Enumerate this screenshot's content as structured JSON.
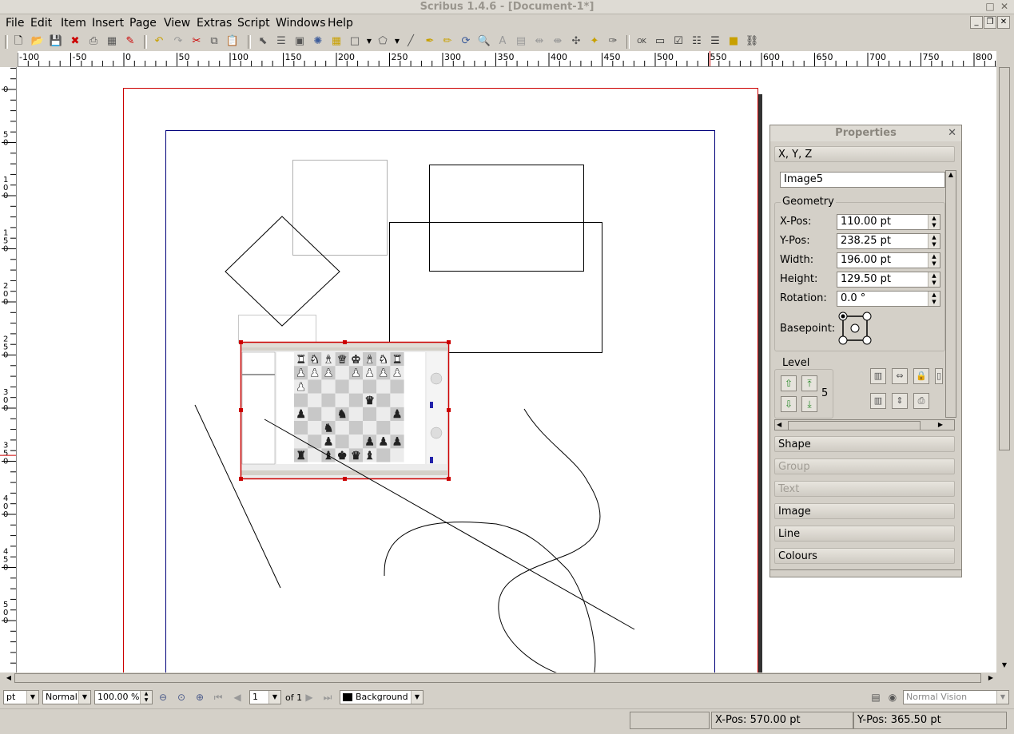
{
  "window": {
    "title": "Scribus 1.4.6 - [Document-1*]"
  },
  "menubar": {
    "items": [
      "File",
      "Edit",
      "Item",
      "Insert",
      "Page",
      "View",
      "Extras",
      "Script",
      "Windows",
      "Help"
    ]
  },
  "toolbar": {
    "icons": [
      "new-document-icon",
      "open-icon",
      "save-icon",
      "close-icon",
      "print-icon",
      "preflight-icon",
      "pdf-export-icon",
      "undo-icon",
      "redo-icon",
      "cut-icon",
      "copy-icon",
      "paste-icon",
      "select-icon",
      "text-frame-icon",
      "image-frame-icon",
      "render-frame-icon",
      "table-icon",
      "shape-icon",
      "polygon-icon",
      "line-icon",
      "bezier-icon",
      "freehand-icon",
      "rotate-icon",
      "zoom-icon",
      "edit-text-icon",
      "story-editor-icon",
      "link-frames-icon",
      "unlink-frames-icon",
      "measure-icon",
      "copy-properties-icon",
      "eyedropper-icon",
      "pdf-button-icon",
      "pdf-textfield-icon",
      "pdf-checkbox-icon",
      "pdf-combobox-icon",
      "pdf-listbox-icon",
      "pdf-annotation-icon",
      "pdf-link-icon"
    ]
  },
  "ruler": {
    "h_labels": [
      "-100",
      "-50",
      "0",
      "50",
      "100",
      "150",
      "200",
      "250",
      "300",
      "350",
      "400",
      "450",
      "500",
      "550",
      "600",
      "650",
      "700",
      "750",
      "800"
    ],
    "v_labels": [
      "0",
      "50",
      "100",
      "150",
      "200",
      "250",
      "300",
      "350",
      "400",
      "450",
      "500"
    ]
  },
  "properties": {
    "title": "Properties",
    "xyz_label": "X, Y, Z",
    "name": "Image5",
    "geometry_label": "Geometry",
    "xpos_label": "X-Pos:",
    "xpos": "110.00 pt",
    "ypos_label": "Y-Pos:",
    "ypos": "238.25 pt",
    "width_label": "Width:",
    "width": "196.00 pt",
    "height_label": "Height:",
    "height": "129.50 pt",
    "rotation_label": "Rotation:",
    "rotation": "0.0 °",
    "basepoint_label": "Basepoint:",
    "level_label": "Level",
    "level": "5",
    "sections": [
      "Shape",
      "Group",
      "Text",
      "Image",
      "Line",
      "Colours"
    ],
    "disabled_sections": [
      "Group",
      "Text"
    ]
  },
  "bottombar": {
    "unit": "pt",
    "mode": "Normal",
    "zoom": "100.00 %",
    "page": "1",
    "of_pages": "of 1",
    "layer": "Background",
    "vision": "Normal Vision"
  },
  "statusbar": {
    "xpos_label": "X-Pos:",
    "xpos": "570.00 pt",
    "ypos_label": "Y-Pos:",
    "ypos": "365.50 pt"
  },
  "colors": {
    "page_border": "#cc0000",
    "margin_guide": "#00007a",
    "selection": "#cc0000"
  }
}
